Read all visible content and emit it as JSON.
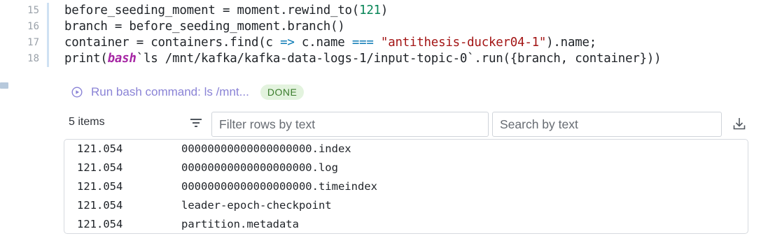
{
  "editor": {
    "lines": [
      {
        "num": "15",
        "parts": {
          "a": "before_seeding_moment = moment.rewind_to(",
          "n": "121",
          "b": ")"
        }
      },
      {
        "num": "16",
        "parts": {
          "a": "branch = before_seeding_moment.branch()"
        }
      },
      {
        "num": "17",
        "parts": {
          "a": "container = containers.find(c ",
          "op": "=>",
          "b": " c.name ",
          "eq": "===",
          "sp": " ",
          "s": "\"antithesis-ducker04-1\"",
          "c": ").name;"
        }
      },
      {
        "num": "18",
        "parts": {
          "a": "print(",
          "kw": "bash",
          "b": "`ls /mnt/kafka/kafka-data-logs-1/input-topic-0`.run({branch, container}))"
        }
      }
    ]
  },
  "run": {
    "label": "Run bash command: ls /mnt...",
    "status": "DONE"
  },
  "toolbar": {
    "items_count": "5 items",
    "filter_placeholder": "Filter rows by text",
    "search_placeholder": "Search by text"
  },
  "table": {
    "rows": [
      {
        "time": "121.054",
        "name": "00000000000000000000.index"
      },
      {
        "time": "121.054",
        "name": "00000000000000000000.log"
      },
      {
        "time": "121.054",
        "name": "00000000000000000000.timeindex"
      },
      {
        "time": "121.054",
        "name": "leader-epoch-checkpoint"
      },
      {
        "time": "121.054",
        "name": "partition.metadata"
      }
    ]
  },
  "icons": {
    "run": "play-circle-icon",
    "filter": "filter-icon",
    "download": "download-icon"
  },
  "colors": {
    "run_label": "#8a83d6",
    "badge_bg": "#e3f3de",
    "badge_text": "#3b7d2c",
    "string": "#a31515",
    "number": "#098658",
    "keyword": "#a626a4"
  }
}
